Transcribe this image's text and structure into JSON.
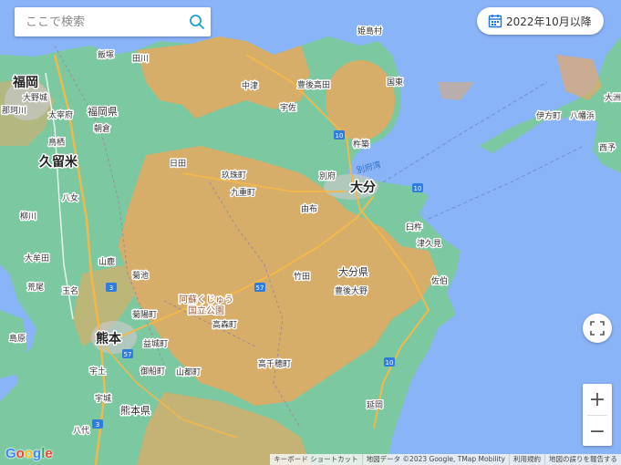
{
  "search": {
    "placeholder": "ここで検索"
  },
  "date_button": {
    "label": "2022年10月以降"
  },
  "map": {
    "places_big": [
      {
        "name": "福岡"
      },
      {
        "name": "久留米"
      },
      {
        "name": "大分"
      },
      {
        "name": "熊本"
      }
    ],
    "places_mid": [
      {
        "name": "福岡県"
      },
      {
        "name": "大分県"
      },
      {
        "name": "熊本県"
      }
    ],
    "places_small": [
      {
        "name": "姫島村"
      },
      {
        "name": "飯塚"
      },
      {
        "name": "田川"
      },
      {
        "name": "大野城"
      },
      {
        "name": "那珂川"
      },
      {
        "name": "太宰府"
      },
      {
        "name": "朝倉"
      },
      {
        "name": "鳥栖"
      },
      {
        "name": "中津"
      },
      {
        "name": "豊後高田"
      },
      {
        "name": "国東"
      },
      {
        "name": "宇佐"
      },
      {
        "name": "杵築"
      },
      {
        "name": "日田"
      },
      {
        "name": "玖珠町"
      },
      {
        "name": "九重町"
      },
      {
        "name": "別府"
      },
      {
        "name": "由布"
      },
      {
        "name": "臼杵"
      },
      {
        "name": "津久見"
      },
      {
        "name": "佐伯"
      },
      {
        "name": "八女"
      },
      {
        "name": "柳川"
      },
      {
        "name": "大牟田"
      },
      {
        "name": "荒尾"
      },
      {
        "name": "玉名"
      },
      {
        "name": "山鹿"
      },
      {
        "name": "菊池"
      },
      {
        "name": "竹田"
      },
      {
        "name": "豊後大野"
      },
      {
        "name": "菊陽町"
      },
      {
        "name": "高森町"
      },
      {
        "name": "益城町"
      },
      {
        "name": "御船町"
      },
      {
        "name": "山都町"
      },
      {
        "name": "高千穂町"
      },
      {
        "name": "宇土"
      },
      {
        "name": "宇城"
      },
      {
        "name": "延岡"
      },
      {
        "name": "八代"
      },
      {
        "name": "島原"
      },
      {
        "name": "伊方町"
      },
      {
        "name": "八幡浜"
      },
      {
        "name": "西予"
      },
      {
        "name": "大洲"
      }
    ],
    "park_label": [
      "阿蘇くじゅう",
      "国立公園"
    ],
    "sea_label": "別府湾",
    "route_badges": [
      "3",
      "10",
      "57",
      "10",
      "10",
      "57",
      "3"
    ]
  },
  "controls": {
    "fullscreen_icon": "fullscreen-icon",
    "zoom_in": "+",
    "zoom_out": "−"
  },
  "logo": {
    "text": "Google"
  },
  "footer": {
    "shortcuts": "キーボード ショートカット",
    "attribution": "地図データ ©2023 Google, TMap Mobility",
    "terms": "利用規約",
    "report": "地図の誤りを報告する"
  },
  "colors": {
    "water": "#8ab4f8",
    "land": "#7cc8a0",
    "coverage": "#e8a860",
    "accent": "#1a73e8"
  }
}
